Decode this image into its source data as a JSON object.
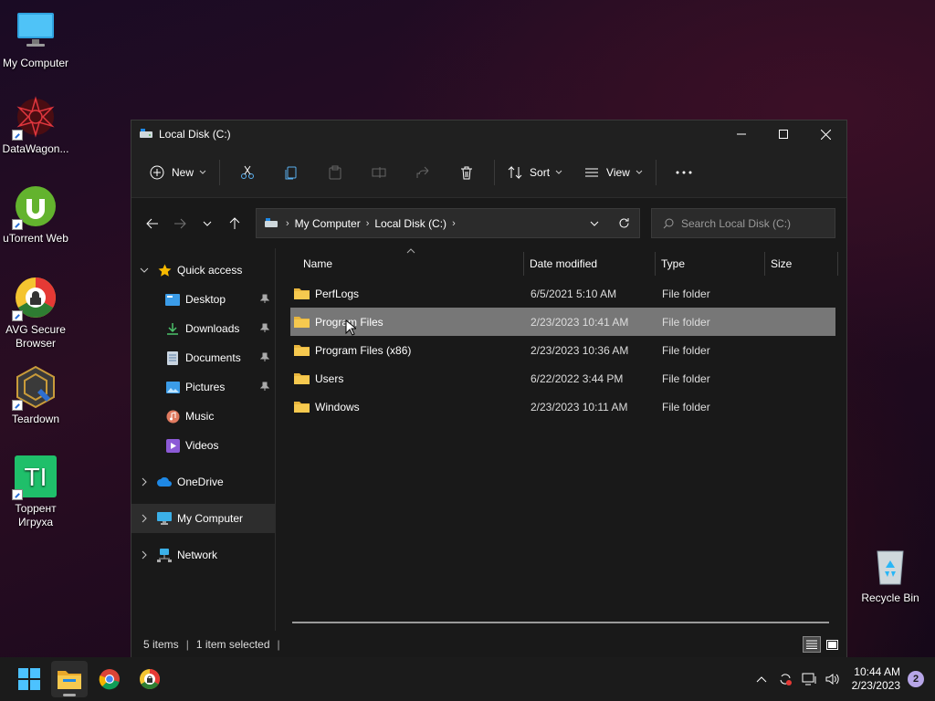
{
  "desktop": {
    "icons": [
      {
        "label": "My Computer",
        "icon": "monitor-icon"
      },
      {
        "label": "DataWagon...",
        "icon": "datawagon-icon"
      },
      {
        "label": "uTorrent Web",
        "icon": "utorrent-icon"
      },
      {
        "label": "AVG Secure Browser",
        "icon": "avg-browser-icon"
      },
      {
        "label": "Teardown",
        "icon": "teardown-icon"
      },
      {
        "label": "Торрент Игруха",
        "icon": "torrent-igruha-icon"
      },
      {
        "label": "Recycle Bin",
        "icon": "recycle-bin-icon"
      }
    ]
  },
  "window": {
    "title": "Local Disk (C:)",
    "toolbar": {
      "new_label": "New",
      "sort_label": "Sort",
      "view_label": "View"
    },
    "address": {
      "crumbs": [
        "My Computer",
        "Local Disk (C:)"
      ]
    },
    "search": {
      "placeholder": "Search Local Disk (C:)"
    },
    "sidebar": {
      "quick_access": "Quick access",
      "items": [
        "Desktop",
        "Downloads",
        "Documents",
        "Pictures",
        "Music",
        "Videos"
      ],
      "onedrive": "OneDrive",
      "my_computer": "My Computer",
      "network": "Network"
    },
    "columns": {
      "name": "Name",
      "date": "Date modified",
      "type": "Type",
      "size": "Size"
    },
    "files": [
      {
        "name": "PerfLogs",
        "date": "6/5/2021 5:10 AM",
        "type": "File folder"
      },
      {
        "name": "Program Files",
        "date": "2/23/2023 10:41 AM",
        "type": "File folder"
      },
      {
        "name": "Program Files (x86)",
        "date": "2/23/2023 10:36 AM",
        "type": "File folder"
      },
      {
        "name": "Users",
        "date": "6/22/2022 3:44 PM",
        "type": "File folder"
      },
      {
        "name": "Windows",
        "date": "2/23/2023 10:11 AM",
        "type": "File folder"
      }
    ],
    "status": {
      "items": "5 items",
      "selected": "1 item selected"
    }
  },
  "taskbar": {
    "time": "10:44 AM",
    "date": "2/23/2023",
    "notifications": "2"
  },
  "colors": {
    "accent": "#0078d4",
    "folder": "#f4c542",
    "selection": "#777777"
  }
}
